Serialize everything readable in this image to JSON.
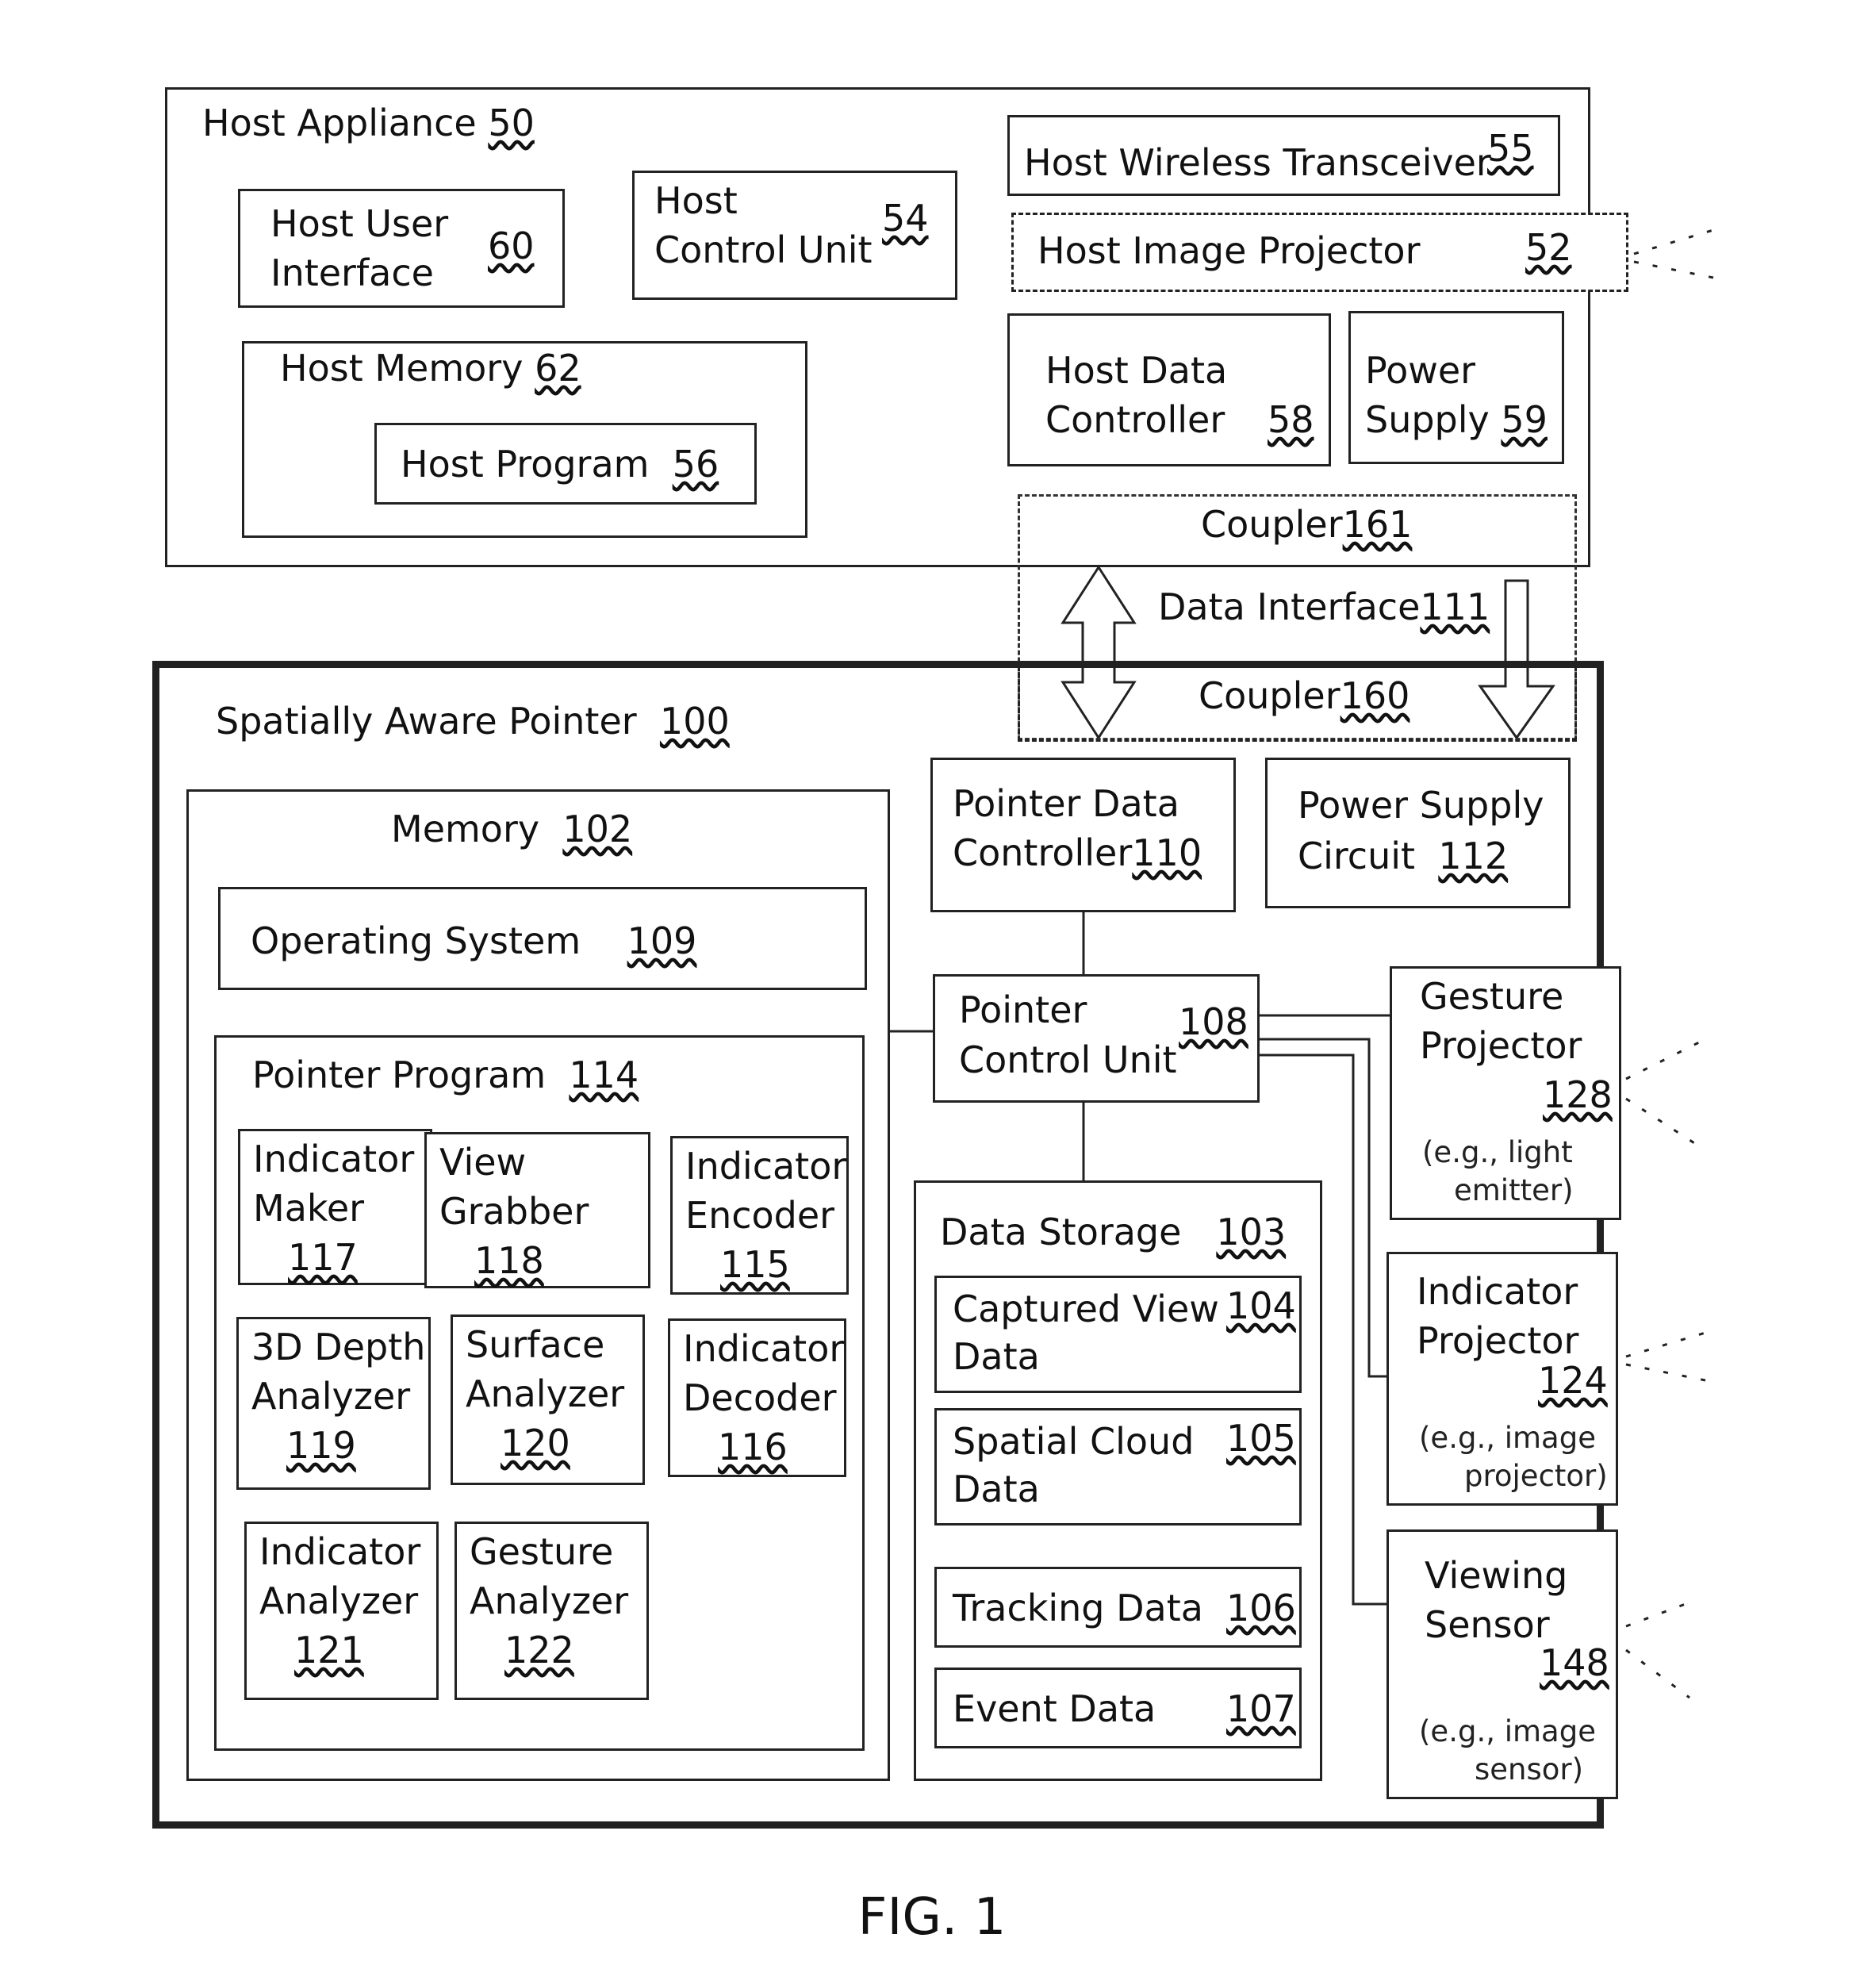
{
  "figure_label": "FIG. 1",
  "host": {
    "title": "Host Appliance",
    "num": "50",
    "user_interface": {
      "line1": "Host User",
      "line2": "Interface",
      "num": "60"
    },
    "control_unit": {
      "line1": "Host",
      "line2": "Control Unit",
      "num": "54"
    },
    "wireless": {
      "label": "Host Wireless Transceiver",
      "num": "55"
    },
    "projector": {
      "label": "Host Image Projector",
      "num": "52"
    },
    "memory": {
      "label": "Host Memory",
      "num": "62"
    },
    "program": {
      "label": "Host Program",
      "num": "56"
    },
    "data_controller": {
      "line1": "Host Data",
      "line2": "Controller",
      "num": "58"
    },
    "power": {
      "line1": "Power",
      "line2": "Supply",
      "num": "59"
    },
    "coupler": {
      "label": "Coupler",
      "num": "161"
    }
  },
  "interface": {
    "label": "Data Interface",
    "num": "111"
  },
  "pointer": {
    "title": "Spatially Aware Pointer",
    "num": "100",
    "coupler": {
      "label": "Coupler",
      "num": "160"
    },
    "memory": {
      "label": "Memory",
      "num": "102"
    },
    "os": {
      "label": "Operating System",
      "num": "109"
    },
    "program": {
      "label": "Pointer Program",
      "num": "114"
    },
    "modules": [
      {
        "line1": "Indicator",
        "line2": "Maker",
        "num": "117"
      },
      {
        "line1": "View",
        "line2": "Grabber",
        "num": "118"
      },
      {
        "line1": "Indicator",
        "line2": "Encoder",
        "num": "115"
      },
      {
        "line1": "3D Depth",
        "line2": "Analyzer",
        "num": "119"
      },
      {
        "line1": "Surface",
        "line2": "Analyzer",
        "num": "120"
      },
      {
        "line1": "Indicator",
        "line2": "Decoder",
        "num": "116"
      },
      {
        "line1": "Indicator",
        "line2": "Analyzer",
        "num": "121"
      },
      {
        "line1": "Gesture",
        "line2": "Analyzer",
        "num": "122"
      }
    ],
    "data_controller": {
      "line1": "Pointer Data",
      "line2": "Controller",
      "num": "110"
    },
    "power_circuit": {
      "line1": "Power Supply",
      "line2": "Circuit",
      "num": "112"
    },
    "control_unit": {
      "line1": "Pointer",
      "line2": "Control Unit",
      "num": "108"
    },
    "storage": {
      "label": "Data Storage",
      "num": "103",
      "items": [
        {
          "line1": "Captured View",
          "line2": "Data",
          "num": "104"
        },
        {
          "line1": "Spatial Cloud",
          "line2": "Data",
          "num": "105"
        },
        {
          "line1": "Tracking Data",
          "line2": "",
          "num": "106"
        },
        {
          "line1": "Event Data",
          "line2": "",
          "num": "107"
        }
      ]
    },
    "gesture_projector": {
      "line1": "Gesture",
      "line2": "Projector",
      "num": "128",
      "note1": "(e.g., light",
      "note2": "emitter)"
    },
    "indicator_projector": {
      "line1": "Indicator",
      "line2": "Projector",
      "num": "124",
      "note1": "(e.g., image",
      "note2": "projector)"
    },
    "viewing_sensor": {
      "line1": "Viewing",
      "line2": "Sensor",
      "num": "148",
      "note1": "(e.g., image",
      "note2": "sensor)"
    }
  }
}
